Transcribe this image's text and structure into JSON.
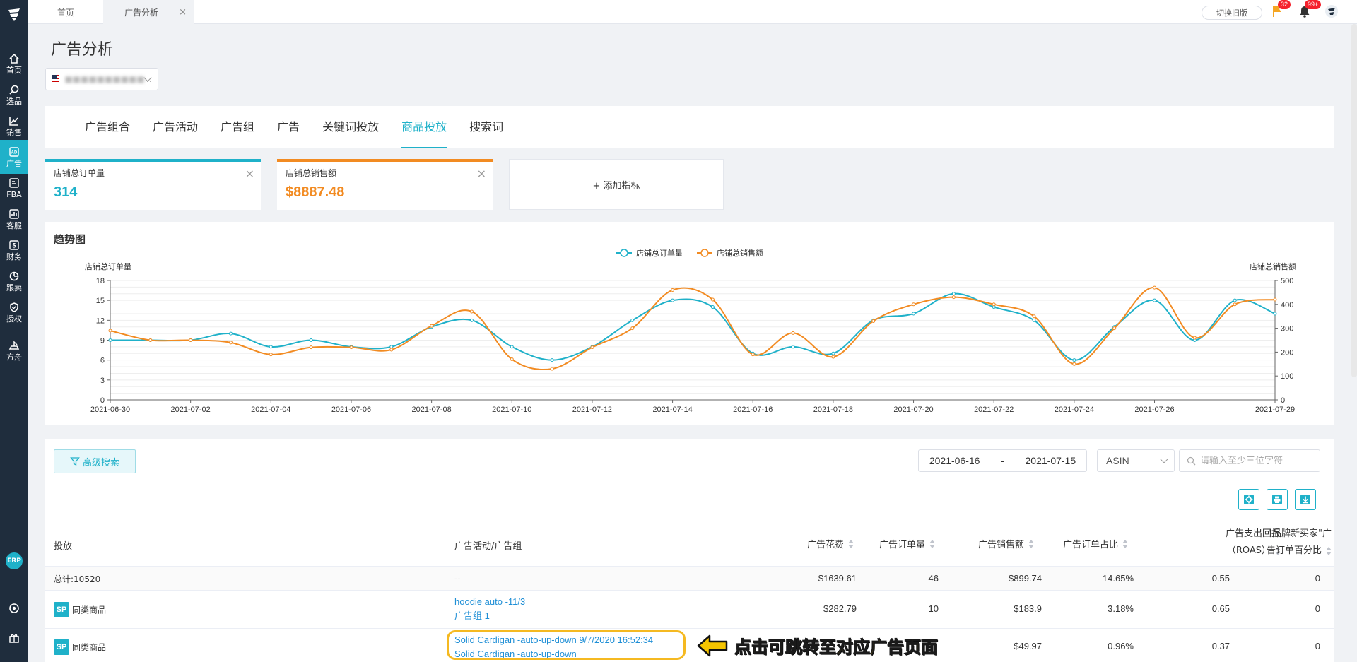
{
  "sidebar": {
    "items": [
      {
        "label": "首页",
        "icon": "home-icon"
      },
      {
        "label": "选品",
        "icon": "search-icon"
      },
      {
        "label": "销售",
        "icon": "line-chart-icon"
      },
      {
        "label": "广告",
        "icon": "ad-icon",
        "active": true
      },
      {
        "label": "FBA",
        "icon": "fba-icon"
      },
      {
        "label": "客服",
        "icon": "bar-chart-icon"
      },
      {
        "label": "财务",
        "icon": "dollar-icon"
      },
      {
        "label": "跟卖",
        "icon": "pie-chart-icon"
      },
      {
        "label": "授权",
        "icon": "shield-icon"
      },
      {
        "label": "方舟",
        "icon": "ark-icon"
      }
    ],
    "erp_label": "ERP"
  },
  "topbar": {
    "tabs": [
      {
        "label": "首页"
      },
      {
        "label": "广告分析",
        "active": true
      }
    ],
    "close_glyph": "×",
    "switch_label": "切换旧版",
    "flag_badge": "32",
    "bell_badge": "99+"
  },
  "page": {
    "title": "广告分析",
    "store_dots": ".."
  },
  "nav_tabs": [
    {
      "label": "广告组合"
    },
    {
      "label": "广告活动"
    },
    {
      "label": "广告组"
    },
    {
      "label": "广告"
    },
    {
      "label": "关键词投放"
    },
    {
      "label": "商品投放",
      "active": true
    },
    {
      "label": "搜索词"
    }
  ],
  "metrics": [
    {
      "title": "店铺总订单量",
      "value": "314",
      "color": "#1fb1c9"
    },
    {
      "title": "店铺总销售额",
      "value": "$8887.48",
      "color": "#f28b22"
    }
  ],
  "add_metric_label": "+ 添加指标",
  "chart_data": {
    "type": "line",
    "title": "趋势图",
    "legend_position": "top-center",
    "ylabel_left": "店铺总订单量",
    "ylabel_right": "店铺总销售额",
    "ylim_left": [
      0,
      18
    ],
    "yticks_left": [
      0,
      3,
      6,
      9,
      12,
      15,
      18
    ],
    "ylim_right": [
      0,
      500
    ],
    "yticks_right": [
      0,
      100,
      200,
      300,
      400,
      500
    ],
    "x_tick_labels": [
      "2021-06-30",
      "2021-07-02",
      "2021-07-04",
      "2021-07-06",
      "2021-07-08",
      "2021-07-10",
      "2021-07-12",
      "2021-07-14",
      "2021-07-16",
      "2021-07-18",
      "2021-07-20",
      "2021-07-22",
      "2021-07-24",
      "2021-07-26",
      "2021-07-29"
    ],
    "x": [
      "2021-06-30",
      "2021-07-01",
      "2021-07-02",
      "2021-07-03",
      "2021-07-04",
      "2021-07-05",
      "2021-07-06",
      "2021-07-07",
      "2021-07-08",
      "2021-07-09",
      "2021-07-10",
      "2021-07-11",
      "2021-07-12",
      "2021-07-13",
      "2021-07-14",
      "2021-07-15",
      "2021-07-16",
      "2021-07-17",
      "2021-07-18",
      "2021-07-19",
      "2021-07-20",
      "2021-07-21",
      "2021-07-22",
      "2021-07-23",
      "2021-07-24",
      "2021-07-25",
      "2021-07-26",
      "2021-07-27",
      "2021-07-28",
      "2021-07-29"
    ],
    "series": [
      {
        "name": "店铺总订单量",
        "axis": "left",
        "color": "#1fb1c9",
        "values": [
          9,
          9,
          9,
          10,
          8,
          9,
          8,
          8,
          11,
          12,
          8,
          6,
          8,
          12,
          15,
          14,
          7,
          8,
          7,
          12,
          13,
          16,
          14,
          12,
          6,
          11,
          15,
          9,
          15,
          13
        ]
      },
      {
        "name": "店铺总销售额",
        "axis": "right",
        "color": "#f28b22",
        "values": [
          290,
          250,
          250,
          240,
          190,
          220,
          220,
          210,
          310,
          370,
          170,
          130,
          220,
          300,
          460,
          420,
          190,
          280,
          180,
          330,
          400,
          430,
          400,
          350,
          150,
          300,
          470,
          260,
          400,
          420
        ]
      }
    ]
  },
  "filters": {
    "advanced_label": "高级搜索",
    "date_start": "2021-06-16",
    "date_sep": "-",
    "date_end": "2021-07-15",
    "type_select": "ASIN",
    "search_placeholder": "请输入至少三位字符"
  },
  "table": {
    "columns": {
      "target": "投放",
      "campaign": "广告活动/广告组",
      "spend": "广告花费",
      "orders": "广告订单量",
      "sales": "广告销售额",
      "order_ratio": "广告订单占比",
      "roas_line1": "广告支出回报",
      "roas_line2": "（ROAS）",
      "newbuyer_line1": "\"品牌新买家\"广",
      "newbuyer_line2": "告订单百分比"
    },
    "total_row": {
      "target": "总计:10520",
      "campaign": "--",
      "spend": "$1639.61",
      "orders": "46",
      "sales": "$899.74",
      "order_ratio": "14.65%",
      "roas": "0.55",
      "newbuyer": "0"
    },
    "rows": [
      {
        "badge": "SP",
        "target": "同类商品",
        "campaign": "hoodie auto -11/3",
        "group": "广告组 1",
        "spend": "$282.79",
        "orders": "10",
        "sales": "$183.9",
        "order_ratio": "3.18%",
        "roas": "0.65",
        "newbuyer": "0"
      },
      {
        "badge": "SP",
        "target": "同类商品",
        "campaign": "Solid Cardigan -auto-up-down 9/7/2020 16:52:34",
        "group": "Solid Cardigan -auto-up-down",
        "spend": "",
        "orders": "",
        "sales": "$49.97",
        "order_ratio": "0.96%",
        "roas": "0.37",
        "newbuyer": "0"
      }
    ]
  },
  "callout": {
    "text": "点击可跳转至对应广告页面",
    "color": "#f5c400"
  }
}
